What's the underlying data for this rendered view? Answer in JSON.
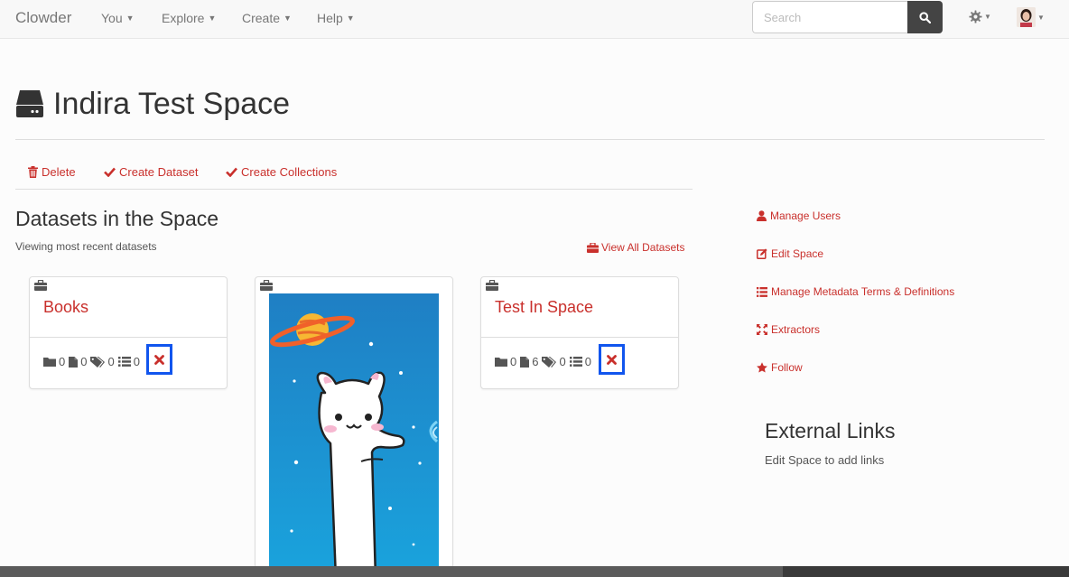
{
  "navbar": {
    "brand": "Clowder",
    "menus": [
      {
        "label": "You"
      },
      {
        "label": "Explore"
      },
      {
        "label": "Create"
      },
      {
        "label": "Help"
      }
    ],
    "search_placeholder": "Search",
    "icons": [
      "search-icon",
      "gear-icon",
      "avatar"
    ]
  },
  "page": {
    "title": "Indira Test Space",
    "title_icon": "hdd-drive-icon"
  },
  "actions": [
    {
      "label": "Delete",
      "icon": "trash-icon"
    },
    {
      "label": "Create Dataset",
      "icon": "check-icon"
    },
    {
      "label": "Create Collections",
      "icon": "check-icon"
    }
  ],
  "datasets_section": {
    "title": "Datasets in the Space",
    "subtitle": "Viewing most recent datasets",
    "view_all": "View All Datasets"
  },
  "cards": [
    {
      "title": "Books",
      "stats": {
        "folders": "0",
        "files": "0",
        "tags": "0",
        "metadata": "0"
      }
    },
    {
      "title": "",
      "image": "cat-planet-image"
    },
    {
      "title": "Test In Space",
      "stats": {
        "folders": "0",
        "files": "6",
        "tags": "0",
        "metadata": "0"
      }
    }
  ],
  "sidebar": {
    "links": [
      {
        "label": "Manage Users",
        "icon": "user-icon"
      },
      {
        "label": "Edit Space",
        "icon": "edit-icon"
      },
      {
        "label": "Manage Metadata Terms & Definitions",
        "icon": "list-icon"
      },
      {
        "label": "Extractors",
        "icon": "fullscreen-icon"
      },
      {
        "label": "Follow",
        "icon": "star-icon"
      }
    ],
    "external_title": "External Links",
    "external_sub": "Edit Space to add links"
  },
  "colors": {
    "accent": "#c9302c",
    "highlight": "#1155ee"
  }
}
